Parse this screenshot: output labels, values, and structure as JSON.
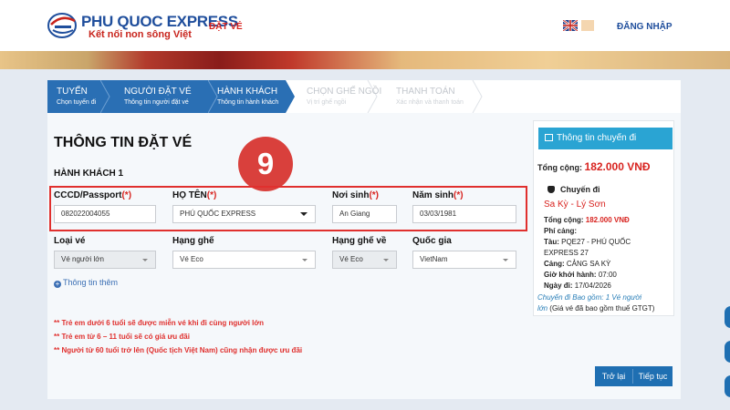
{
  "header": {
    "brand": "PHU QUOC EXPRESS",
    "slogan": "Kết nối non sông Việt",
    "nav_ticket": "ĐẶT VÉ",
    "login": "ĐĂNG NHẬP"
  },
  "steps": [
    {
      "title": "TUYẾN",
      "sub": "Chọn tuyến đi",
      "active": true
    },
    {
      "title": "NGƯỜI ĐẶT VÉ",
      "sub": "Thông tin người đặt vé",
      "active": true
    },
    {
      "title": "HÀNH KHÁCH",
      "sub": "Thông tin hành khách",
      "active": true
    },
    {
      "title": "CHỌN GHẾ NGỒI",
      "sub": "Vị trí ghế ngồi",
      "active": false
    },
    {
      "title": "THANH TOÁN",
      "sub": "Xác nhận và thanh toán",
      "active": false
    }
  ],
  "form": {
    "title": "THÔNG TIN ĐẶT VÉ",
    "section": "HÀNH KHÁCH 1",
    "badge": "9",
    "required_mark": "(*)",
    "cccd_label": "CCCD/Passport",
    "cccd_value": "082022004055",
    "name_label": "HỌ TÊN",
    "name_value": "PHÚ QUỐC EXPRESS",
    "birthplace_label": "Nơi sinh",
    "birthplace_value": "An Giang",
    "birthyear_label": "Năm sinh",
    "birthyear_value": "03/03/1981",
    "ticket_type_label": "Loại vé",
    "ticket_type_value": "Vé người lớn",
    "seat_class_label": "Hạng ghế",
    "seat_class_value": "Vé Eco",
    "return_seat_label": "Hạng ghế về",
    "return_seat_value": "Vé Eco",
    "nationality_label": "Quốc gia",
    "nationality_value": "VietNam",
    "more_info": "Thông tin thêm"
  },
  "notes": [
    "** Trẻ em dưới 6 tuổi sẽ được miễn vé khi đi cùng người lớn",
    "** Trẻ em từ 6 – 11 tuổi sẽ có giá ưu đãi",
    "** Người từ 60 tuổi trở lên (Quốc tịch Việt Nam) cũng nhận được ưu đãi"
  ],
  "buttons": {
    "back": "Trở lại",
    "next": "Tiếp tục"
  },
  "trip": {
    "header": "Thông tin chuyến đi",
    "total_label": "Tổng cộng:",
    "total_value": "182.000 VNĐ",
    "section": "Chuyến đi",
    "route": "Sa Kỳ - Lý Sơn",
    "sub_total_label": "Tổng cộng:",
    "sub_total_value": "182.000 VNĐ",
    "port_fee": "Phí cảng:",
    "ship_label": "Tàu:",
    "ship_value": "PQE27 - PHÚ QUỐC",
    "ship_value2": "EXPRESS 27",
    "port_label": "Cảng:",
    "port_value": "CẢNG SA KỲ",
    "depart_label": "Giờ khởi hành:",
    "depart_value": "07:00",
    "date_label": "Ngày đi:",
    "date_value": "17/04/2026",
    "include1": "Chuyến đi Bao gồm: 1 Vé người",
    "include2a": "lớn",
    "include2b": " (Giá vé đã bao gồm thuế GTGT)"
  },
  "colors": {
    "primary": "#1f6fb2",
    "accent_red": "#d8231f",
    "step_active": "#2a6fb4",
    "trip_header": "#2aa4d3"
  }
}
